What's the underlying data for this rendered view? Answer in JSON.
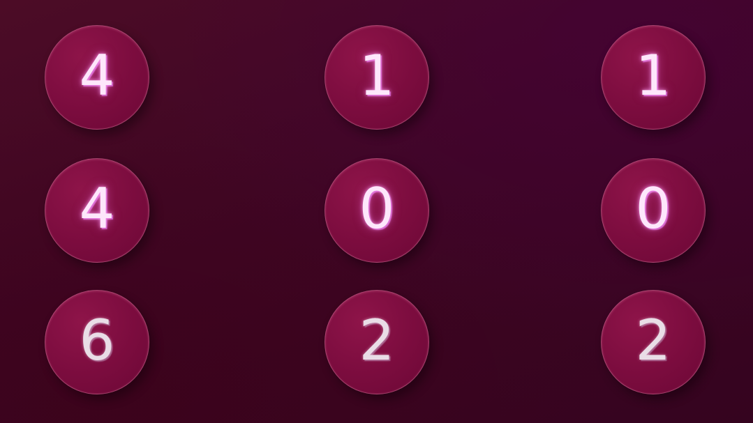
{
  "grid": {
    "rows": [
      [
        "4",
        "1",
        "1"
      ],
      [
        "4",
        "0",
        "0"
      ],
      [
        "6",
        "2",
        "2"
      ]
    ]
  },
  "colors": {
    "background": "#3f0624",
    "circle_fill": "#7b0c3e",
    "digit_glow": "#f0a0f0"
  }
}
